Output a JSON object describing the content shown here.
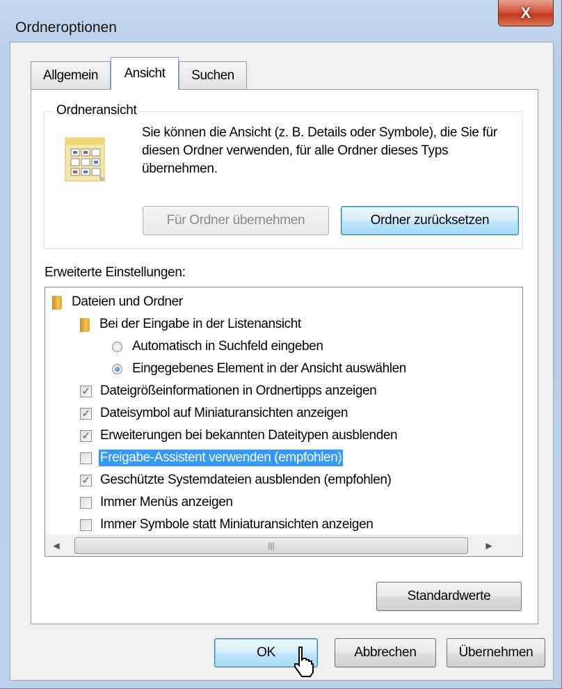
{
  "window": {
    "title": "Ordneroptionen",
    "close_glyph": "X"
  },
  "tabs": [
    {
      "label": "Allgemein"
    },
    {
      "label": "Ansicht"
    },
    {
      "label": "Suchen"
    }
  ],
  "folder_view": {
    "legend": "Ordneransicht",
    "description": "Sie können die Ansicht (z. B. Details oder Symbole), die Sie für diesen Ordner verwenden, für alle Ordner dieses Typs übernehmen.",
    "apply_button": "Für Ordner übernehmen",
    "reset_button": "Ordner zurücksetzen"
  },
  "advanced": {
    "label": "Erweiterte Einstellungen:",
    "items": [
      {
        "type": "folder",
        "label": "Dateien und Ordner"
      },
      {
        "type": "folder",
        "label": "Bei der Eingabe in der Listenansicht"
      },
      {
        "type": "radio",
        "label": "Automatisch in Suchfeld eingeben",
        "checked": false
      },
      {
        "type": "radio",
        "label": "Eingegebenes Element in der Ansicht auswählen",
        "checked": true
      },
      {
        "type": "checkbox",
        "label": "Dateigrößeinformationen in Ordnertipps anzeigen",
        "checked": true
      },
      {
        "type": "checkbox",
        "label": "Dateisymbol auf Miniaturansichten anzeigen",
        "checked": true
      },
      {
        "type": "checkbox",
        "label": "Erweiterungen bei bekannten Dateitypen ausblenden",
        "checked": true
      },
      {
        "type": "checkbox",
        "label": "Freigabe-Assistent verwenden (empfohlen)",
        "checked": false,
        "selected": true
      },
      {
        "type": "checkbox",
        "label": "Geschützte Systemdateien ausblenden (empfohlen)",
        "checked": true
      },
      {
        "type": "checkbox",
        "label": "Immer Menüs anzeigen",
        "checked": false
      },
      {
        "type": "checkbox",
        "label": "Immer Symbole statt Miniaturansichten anzeigen",
        "checked": false
      }
    ],
    "defaults_button": "Standardwerte"
  },
  "footer": {
    "ok": "OK",
    "cancel": "Abbrechen",
    "apply": "Übernehmen"
  },
  "colors": {
    "selection": "#3399ff",
    "close_button": "#c0381f",
    "focus_button": "#bee6fd"
  }
}
